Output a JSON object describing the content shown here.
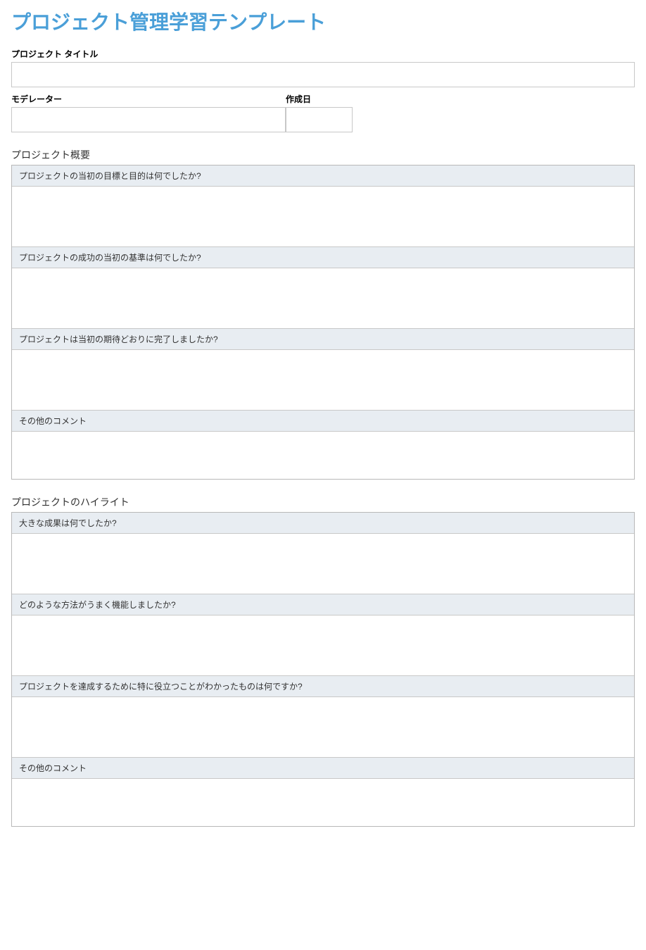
{
  "title": "プロジェクト管理学習テンプレート",
  "fields": {
    "project_title_label": "プロジェクト タイトル",
    "project_title_value": "",
    "moderator_label": "モデレーター",
    "moderator_value": "",
    "created_date_label": "作成日",
    "created_date_value": ""
  },
  "sections": {
    "overview": {
      "title": "プロジェクト概要",
      "q1": "プロジェクトの当初の目標と目的は何でしたか?",
      "a1": "",
      "q2": "プロジェクトの成功の当初の基準は何でしたか?",
      "a2": "",
      "q3": "プロジェクトは当初の期待どおりに完了しましたか?",
      "a3": "",
      "q4": "その他のコメント",
      "a4": ""
    },
    "highlights": {
      "title": "プロジェクトのハイライト",
      "q1": "大きな成果は何でしたか?",
      "a1": "",
      "q2": "どのような方法がうまく機能しましたか?",
      "a2": "",
      "q3": "プロジェクトを達成するために特に役立つことがわかったものは何ですか?",
      "a3": "",
      "q4": "その他のコメント",
      "a4": ""
    }
  }
}
